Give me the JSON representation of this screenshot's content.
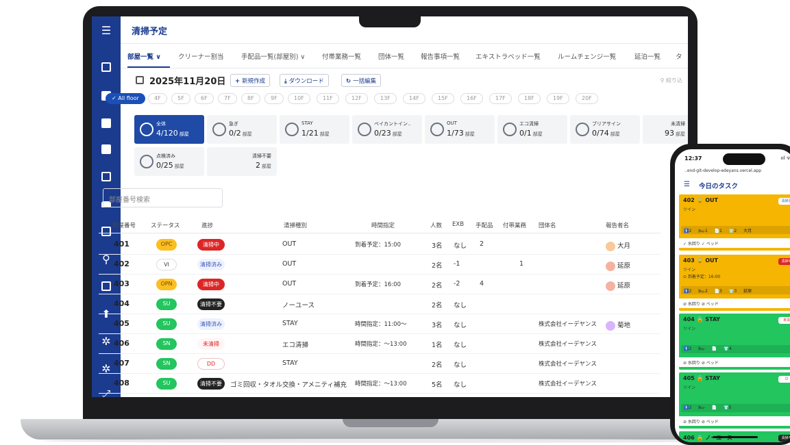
{
  "app": {
    "page_title": "清掃予定"
  },
  "tabs": [
    {
      "label": "部屋一覧 ∨",
      "active": true
    },
    {
      "label": "クリーナー割当",
      "active": false
    },
    {
      "label": "手配品一覧(部屋別) ∨",
      "active": false
    },
    {
      "label": "付帯業務一覧",
      "active": false
    },
    {
      "label": "団体一覧",
      "active": false
    },
    {
      "label": "報告事項一覧",
      "active": false
    },
    {
      "label": "エキストラベッド一覧",
      "active": false
    },
    {
      "label": "ルームチェンジ一覧",
      "active": false
    },
    {
      "label": "延泊一覧",
      "active": false
    },
    {
      "label": "タ",
      "active": false
    }
  ],
  "toolbar": {
    "date": "2025年11月20日",
    "new_button": "新規作成",
    "download_button": "ダウンロード",
    "bulk_edit_button": "一括編集",
    "sort_label": "絞り込"
  },
  "floors": [
    "✓ All floor",
    "4F",
    "5F",
    "6F",
    "7F",
    "8F",
    "9F",
    "10F",
    "11F",
    "12F",
    "13F",
    "14F",
    "15F",
    "16F",
    "17F",
    "18F",
    "19F",
    "20F"
  ],
  "summary_cards": [
    {
      "label": "全体",
      "value": "4/120",
      "unit": "部屋",
      "active": true,
      "ring": true
    },
    {
      "label": "急ぎ",
      "value": "0/2",
      "unit": "部屋",
      "active": false,
      "ring": true
    },
    {
      "label": "STAY",
      "value": "1/21",
      "unit": "部屋",
      "active": false,
      "ring": true
    },
    {
      "label": "ベイカントイン‥",
      "value": "0/23",
      "unit": "部屋",
      "active": false,
      "ring": true
    },
    {
      "label": "OUT",
      "value": "1/73",
      "unit": "部屋",
      "active": false,
      "ring": true
    },
    {
      "label": "エコ清掃",
      "value": "0/1",
      "unit": "部屋",
      "active": false,
      "ring": true
    },
    {
      "label": "ブリアサイン",
      "value": "0/74",
      "unit": "部屋",
      "active": false,
      "ring": true
    },
    {
      "label": "未清掃",
      "value": "93",
      "unit": "部屋",
      "active": false,
      "ring": false
    },
    {
      "label": "点検済み",
      "value": "0/25",
      "unit": "部屋",
      "active": false,
      "ring": true
    },
    {
      "label": "清掃不要",
      "value": "2",
      "unit": "部屋",
      "active": false,
      "ring": false
    }
  ],
  "search": {
    "placeholder": "部屋番号検索"
  },
  "table": {
    "headers": [
      "部屋番号",
      "ステータス",
      "進捗",
      "清掃種別",
      "時間指定",
      "人数",
      "EXB",
      "手配品",
      "付帯業務",
      "団体名",
      "報告者名"
    ],
    "rows": [
      {
        "room": "401",
        "status": "OPC",
        "progress": "清掃中",
        "type": "OUT",
        "time": "到着予定：15:00",
        "people": "3名",
        "exb": "なし",
        "items": "2",
        "extra": "",
        "group": "",
        "reporter": "大月"
      },
      {
        "room": "402",
        "status": "VI",
        "progress": "清掃済み",
        "type": "OUT",
        "time": "",
        "people": "2名",
        "exb": "-1",
        "items": "",
        "extra": "1",
        "group": "",
        "reporter": "延原"
      },
      {
        "room": "403",
        "status": "OPN",
        "progress": "清掃中",
        "type": "OUT",
        "time": "到着予定：16:00",
        "people": "2名",
        "exb": "-2",
        "items": "4",
        "extra": "",
        "group": "",
        "reporter": "延原"
      },
      {
        "room": "404",
        "status": "SU",
        "progress": "清掃不要",
        "type": "ノーユース",
        "time": "",
        "people": "2名",
        "exb": "なし",
        "items": "",
        "extra": "",
        "group": "",
        "reporter": ""
      },
      {
        "room": "405",
        "status": "SU",
        "progress": "清掃済み",
        "type": "STAY",
        "time": "時間指定：11:00～",
        "people": "3名",
        "exb": "なし",
        "items": "",
        "extra": "",
        "group": "株式会社イーデヤンス",
        "reporter": "菊地"
      },
      {
        "room": "406",
        "status": "SN",
        "progress": "未清掃",
        "type": "エコ清掃",
        "time": "時間指定：～13:00",
        "people": "1名",
        "exb": "なし",
        "items": "",
        "extra": "",
        "group": "株式会社イーデヤンス",
        "reporter": ""
      },
      {
        "room": "407",
        "status": "SN",
        "progress": "DD",
        "type": "STAY",
        "time": "",
        "people": "2名",
        "exb": "なし",
        "items": "",
        "extra": "",
        "group": "株式会社イーデヤンス",
        "reporter": ""
      },
      {
        "room": "408",
        "status": "SU",
        "progress": "清掃不要",
        "type": "ゴミ回収・タオル交換・アメニティ補充",
        "time": "時間指定：～13:00",
        "people": "5名",
        "exb": "なし",
        "items": "",
        "extra": "",
        "group": "株式会社イーデヤンス",
        "reporter": ""
      }
    ]
  },
  "colors": {
    "brand": "#1b3b8f",
    "status_yellow": "#fbbf24",
    "status_green": "#22c55e",
    "progress_red": "#dc2626",
    "progress_black": "#222222",
    "phone_out_card": "#f5b500",
    "phone_stay_card": "#22c55e"
  },
  "phone": {
    "time": "12:37",
    "status_bar": "ııl ᯤ",
    "url": "..end-git-develop-edeyans.vercel.app",
    "title": "今日のタスク",
    "cards": [
      {
        "head": "402 🔒 OUT",
        "sub": "ツイン",
        "sub2": "",
        "badge": "清掃済",
        "icons": "🚹2 🛏-1 📄1 👕2 大月",
        "foot": "✓ 水回り ✓ ベッド",
        "color": "orange"
      },
      {
        "head": "403 🔒 OUT",
        "sub": "ツイン",
        "sub2": "⊙ 到着予定：16:00",
        "badge": "清掃中",
        "icons": "🚹2 🛏-2 📄3 👕3 延原",
        "foot": "⊘ 水回り ⊘ ベッド",
        "color": "orange"
      },
      {
        "head": "404 🔒 STAY",
        "sub": "ツイン",
        "sub2": "",
        "badge": "未清",
        "icons": "🚹2 🛏- 📄 👕4 ",
        "foot": "⊘ 水回り ⊘ ベッド",
        "color": "green"
      },
      {
        "head": "405 🔒 STAY",
        "sub": "ツイン",
        "sub2": "",
        "badge": "D",
        "icons": "🚹2 🛏- 📄 👕5 ",
        "foot": "⊘ 水回り ⊘ ベッド",
        "color": "green"
      },
      {
        "head": "406 🔒 ノーユース",
        "sub": "",
        "sub2": "",
        "badge": "清掃不",
        "icons": "",
        "foot": "",
        "color": "green"
      }
    ]
  }
}
